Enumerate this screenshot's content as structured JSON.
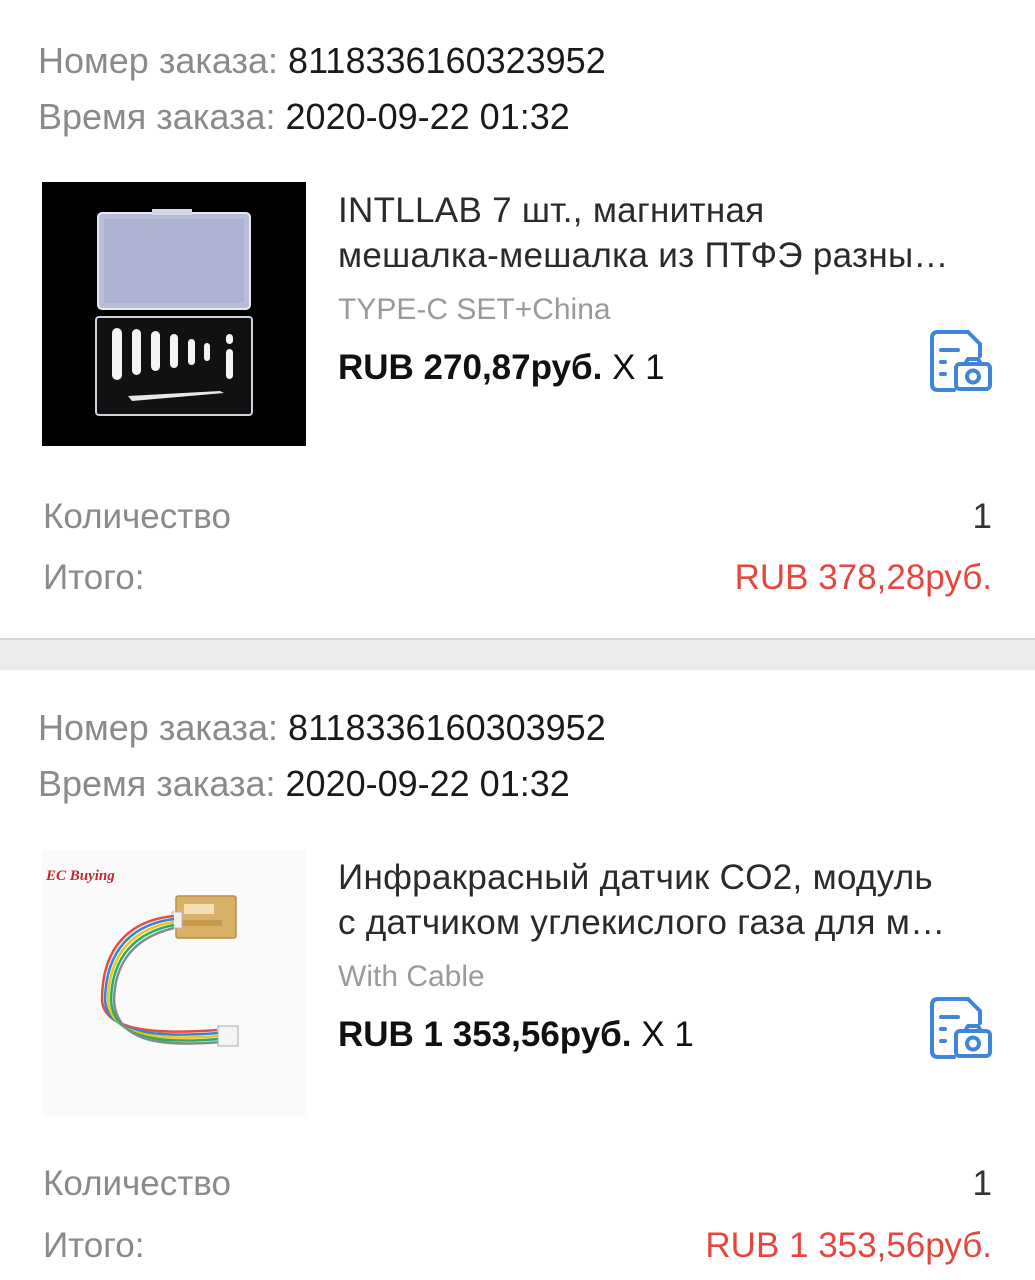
{
  "orders": [
    {
      "order_number_label": "Номер заказа:",
      "order_number": "8118336160323952",
      "order_time_label": "Время заказа:",
      "order_time": "2020-09-22 01:32",
      "product": {
        "title_line1": "INTLLAB 7 шт., магнитная",
        "title_line2": "мешалка-мешалка из ПТФЭ разны…",
        "variant": "TYPE-C SET+China",
        "price": "RUB 270,87руб.",
        "quantity_multiplier": "X 1",
        "image_icon": "stir-bar-set-image"
      },
      "quantity_label": "Количество",
      "quantity_value": "1",
      "total_label": "Итого:",
      "total_value": "RUB 378,28руб."
    },
    {
      "order_number_label": "Номер заказа:",
      "order_number": "8118336160303952",
      "order_time_label": "Время заказа:",
      "order_time": "2020-09-22 01:32",
      "product": {
        "title_line1": "Инфракрасный датчик CO2, модуль",
        "title_line2": "с датчиком углекислого газа для м…",
        "variant": "With Cable",
        "price": "RUB 1 353,56руб.",
        "quantity_multiplier": "X 1",
        "image_icon": "co2-sensor-image",
        "image_caption": "EC Buying"
      },
      "quantity_label": "Количество",
      "quantity_value": "1",
      "total_label": "Итого:",
      "total_value": "RUB 1 353,56руб."
    }
  ],
  "colors": {
    "accent_blue": "#3f86d9",
    "total_red": "#e5473f",
    "label_gray": "#8a8a8a",
    "page_background": "#ececec"
  },
  "icons": {
    "photo_review_icon": "document-camera-icon"
  }
}
